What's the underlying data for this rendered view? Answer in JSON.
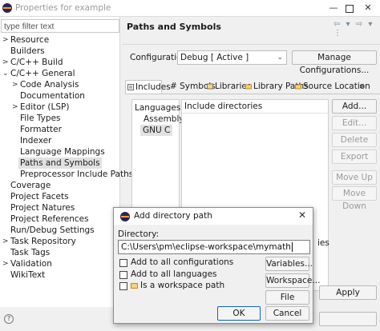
{
  "window": {
    "title": "Properties for example",
    "minimize": "—",
    "close": "✕"
  },
  "filter": {
    "placeholder": "type filter text"
  },
  "tree": {
    "resource": "Resource",
    "builders": "Builders",
    "cpp_build": "C/C++ Build",
    "cpp_general": "C/C++ General",
    "code_analysis": "Code Analysis",
    "documentation": "Documentation",
    "editor_lsp": "Editor (LSP)",
    "file_types": "File Types",
    "formatter": "Formatter",
    "indexer": "Indexer",
    "language_mappings": "Language Mappings",
    "paths_and_symbols": "Paths and Symbols",
    "preprocessor": "Preprocessor Include Paths, M",
    "coverage": "Coverage",
    "project_facets": "Project Facets",
    "project_natures": "Project Natures",
    "project_references": "Project References",
    "run_debug": "Run/Debug Settings",
    "task_repository": "Task Repository",
    "task_tags": "Task Tags",
    "validation": "Validation",
    "wikitext": "WikiText"
  },
  "page": {
    "title": "Paths and Symbols",
    "nav_arrows": "⇦ ▾ ⇨ ▾ ⋮"
  },
  "config": {
    "label": "Configuration:",
    "value": "Debug  [ Active ]",
    "manage_label": "Manage Configurations..."
  },
  "tabs": {
    "includes": "Includes",
    "symbols": "# Symbols",
    "libraries": "Libraries",
    "library_paths": "Library Paths",
    "source_location": "Source Location",
    "overflow": "»"
  },
  "languages": {
    "header": "Languages",
    "assembly": "Assembly",
    "gnu_c": "GNU C"
  },
  "includes": {
    "header": "Include directories",
    "partial_text": "ies"
  },
  "side_buttons": {
    "add": "Add...",
    "edit": "Edit...",
    "delete": "Delete",
    "export": "Export",
    "move_up": "Move Up",
    "move_down": "Move Down"
  },
  "apply": {
    "label": "Apply"
  },
  "dialog": {
    "title": "Add directory path",
    "close": "✕",
    "directory_label": "Directory:",
    "directory_value": "C:\\Users\\pm\\eclipse-workspace\\mymath",
    "opt_all_configs": "Add to all configurations",
    "opt_all_languages": "Add to all languages",
    "opt_workspace": "Is a workspace path",
    "variables": "Variables...",
    "workspace": "Workspace...",
    "file_system": "File system...",
    "ok": "OK",
    "cancel": "Cancel"
  }
}
